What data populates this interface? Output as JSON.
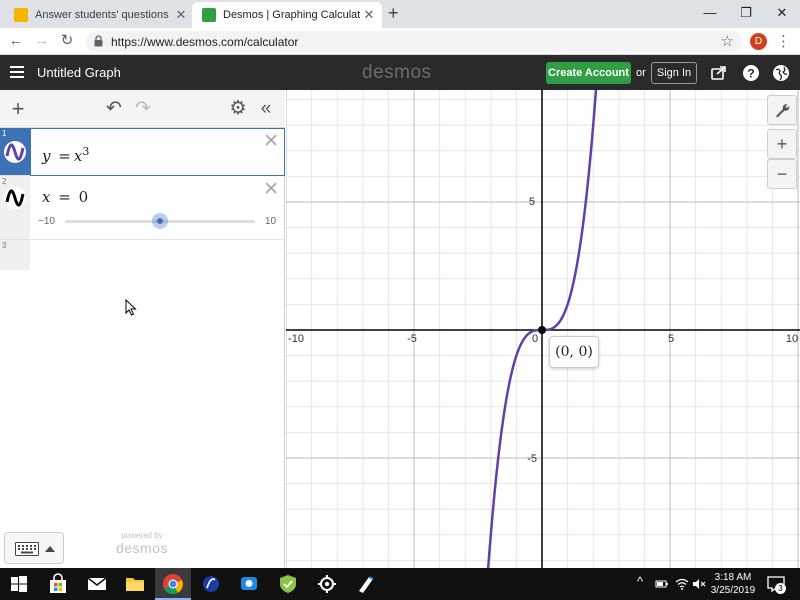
{
  "browser": {
    "tabs": [
      {
        "title": "Answer students' questions and h",
        "active": false
      },
      {
        "title": "Desmos | Graphing Calculator",
        "active": true
      }
    ],
    "url": "https://www.desmos.com/calculator",
    "profile_initial": "D"
  },
  "header": {
    "graph_title": "Untitled Graph",
    "brand": "desmos",
    "create_account_label": "Create Account",
    "or_text": "or",
    "sign_in_label": "Sign In"
  },
  "expressions": [
    {
      "number": "1",
      "latex_lhs": "y",
      "latex_rhs_base": "x",
      "latex_rhs_exp": "3",
      "color": "#6042a6"
    },
    {
      "number": "2",
      "lhs": "x",
      "rhs": "0",
      "color": "#000000",
      "slider": {
        "min": "−10",
        "max": "10",
        "value": 0
      }
    },
    {
      "number": "3"
    }
  ],
  "powered_by": {
    "line1": "powered by",
    "line2": "desmos"
  },
  "graph": {
    "x_ticks": [
      "-10",
      "-5",
      "0",
      "5",
      "10"
    ],
    "y_ticks": [
      "5",
      "-5"
    ],
    "curve_color": "#6042a6",
    "point_label": "(0, 0)",
    "zoom_in_label": "+",
    "zoom_out_label": "−"
  },
  "taskbar": {
    "time": "3:18 AM",
    "date": "3/25/2019",
    "notification_count": "3"
  }
}
